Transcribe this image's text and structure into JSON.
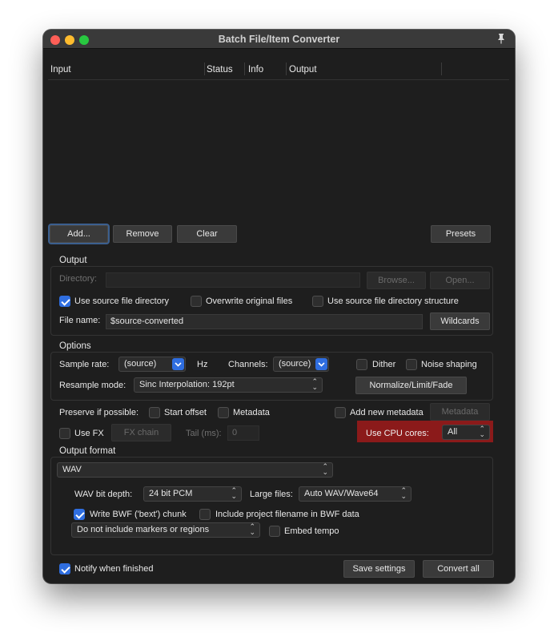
{
  "window": {
    "title": "Batch File/Item Converter"
  },
  "colors": {
    "close": "#ff5f57",
    "minimize": "#febc2e",
    "zoom": "#28c840",
    "accent": "#2f6ee0",
    "cpu_highlight": "#8b1a1a"
  },
  "list": {
    "columns": [
      "Input",
      "Status",
      "Info",
      "Output"
    ]
  },
  "list_buttons": {
    "add": "Add...",
    "remove": "Remove",
    "clear": "Clear",
    "presets": "Presets"
  },
  "output": {
    "heading": "Output",
    "directory_label": "Directory:",
    "browse": "Browse...",
    "open": "Open...",
    "use_source_dir": "Use source file directory",
    "overwrite": "Overwrite original files",
    "use_source_structure": "Use source file directory structure",
    "filename_label": "File name:",
    "filename_value": "$source-converted",
    "wildcards": "Wildcards"
  },
  "options": {
    "heading": "Options",
    "sample_rate_label": "Sample rate:",
    "sample_rate_value": "(source)",
    "hz": "Hz",
    "channels_label": "Channels:",
    "channels_value": "(source)",
    "dither": "Dither",
    "noise_shaping": "Noise shaping",
    "resample_label": "Resample mode:",
    "resample_value": "Sinc Interpolation: 192pt",
    "normalize": "Normalize/Limit/Fade"
  },
  "preserve": {
    "label": "Preserve if possible:",
    "start_offset": "Start offset",
    "metadata": "Metadata",
    "add_new_metadata": "Add new metadata",
    "metadata_button": "Metadata",
    "use_fx": "Use FX",
    "fx_chain": "FX chain",
    "tail_label": "Tail (ms):",
    "tail_value": "0",
    "cpu_label": "Use CPU cores:",
    "cpu_value": "All"
  },
  "format": {
    "heading": "Output format",
    "format_value": "WAV",
    "bit_depth_label": "WAV bit depth:",
    "bit_depth_value": "24 bit PCM",
    "large_files_label": "Large files:",
    "large_files_value": "Auto WAV/Wave64",
    "bwf": "Write BWF ('bext') chunk",
    "include_project": "Include project filename in BWF data",
    "markers_value": "Do not include markers or regions",
    "embed_tempo": "Embed tempo"
  },
  "footer": {
    "notify": "Notify when finished",
    "save": "Save settings",
    "convert": "Convert all"
  }
}
